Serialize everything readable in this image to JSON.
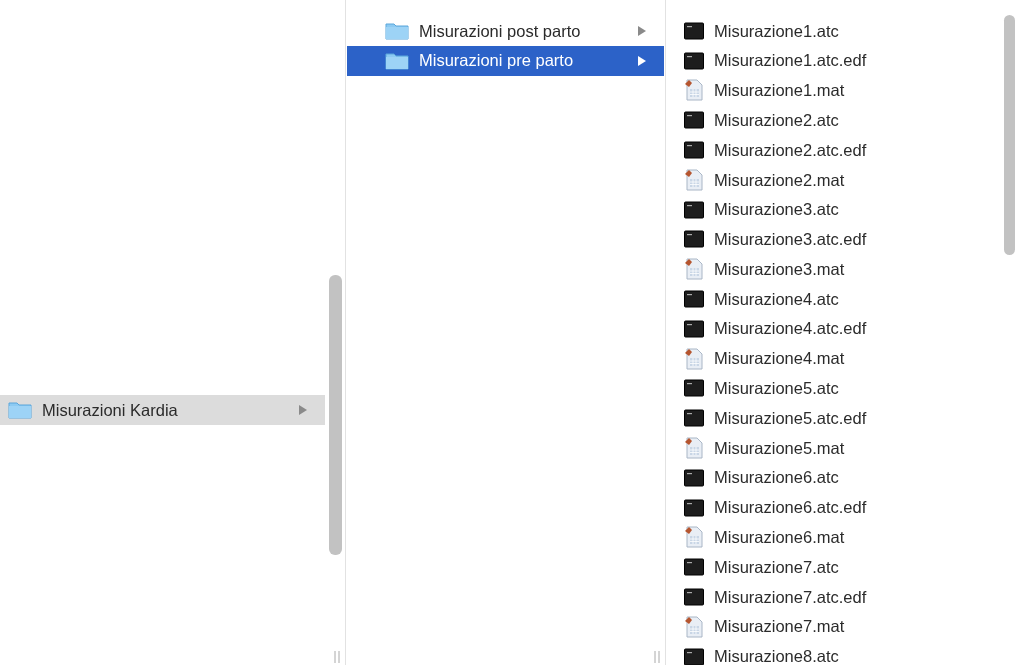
{
  "columns": [
    {
      "focused": false,
      "items": [
        {
          "kind": "folder",
          "label": "Misurazioni Kardia",
          "selected": true
        }
      ]
    },
    {
      "focused": true,
      "items": [
        {
          "kind": "folder",
          "label": "Misurazioni post parto",
          "selected": false
        },
        {
          "kind": "folder",
          "label": "Misurazioni pre parto",
          "selected": true
        }
      ]
    },
    {
      "items": [
        {
          "kind": "terminal",
          "label": "Misurazione1.atc",
          "selected": false
        },
        {
          "kind": "terminal",
          "label": "Misurazione1.atc.edf",
          "selected": false
        },
        {
          "kind": "document",
          "label": "Misurazione1.mat",
          "selected": false
        },
        {
          "kind": "terminal",
          "label": "Misurazione2.atc",
          "selected": false
        },
        {
          "kind": "terminal",
          "label": "Misurazione2.atc.edf",
          "selected": false
        },
        {
          "kind": "document",
          "label": "Misurazione2.mat",
          "selected": false
        },
        {
          "kind": "terminal",
          "label": "Misurazione3.atc",
          "selected": false
        },
        {
          "kind": "terminal",
          "label": "Misurazione3.atc.edf",
          "selected": false
        },
        {
          "kind": "document",
          "label": "Misurazione3.mat",
          "selected": false
        },
        {
          "kind": "terminal",
          "label": "Misurazione4.atc",
          "selected": false
        },
        {
          "kind": "terminal",
          "label": "Misurazione4.atc.edf",
          "selected": false
        },
        {
          "kind": "document",
          "label": "Misurazione4.mat",
          "selected": false
        },
        {
          "kind": "terminal",
          "label": "Misurazione5.atc",
          "selected": false
        },
        {
          "kind": "terminal",
          "label": "Misurazione5.atc.edf",
          "selected": false
        },
        {
          "kind": "document",
          "label": "Misurazione5.mat",
          "selected": false
        },
        {
          "kind": "terminal",
          "label": "Misurazione6.atc",
          "selected": false
        },
        {
          "kind": "terminal",
          "label": "Misurazione6.atc.edf",
          "selected": false
        },
        {
          "kind": "document",
          "label": "Misurazione6.mat",
          "selected": false
        },
        {
          "kind": "terminal",
          "label": "Misurazione7.atc",
          "selected": false
        },
        {
          "kind": "terminal",
          "label": "Misurazione7.atc.edf",
          "selected": false
        },
        {
          "kind": "document",
          "label": "Misurazione7.mat",
          "selected": false
        },
        {
          "kind": "terminal",
          "label": "Misurazione8.atc",
          "selected": false
        }
      ]
    }
  ]
}
